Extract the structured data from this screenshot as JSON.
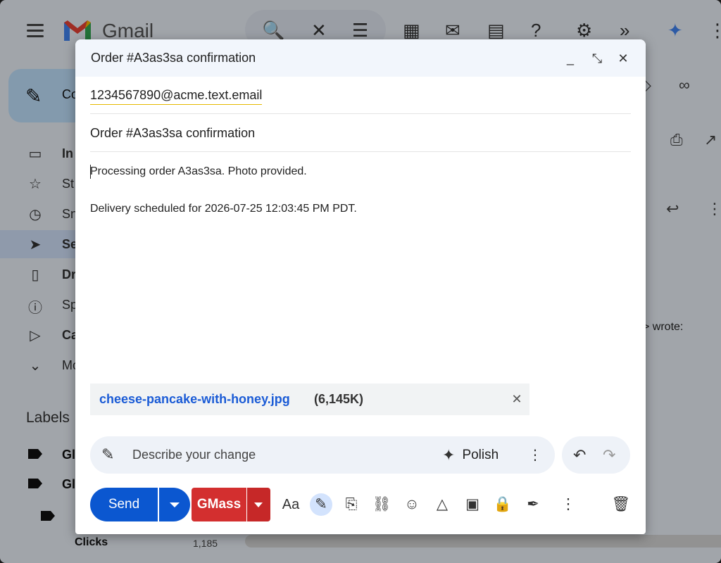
{
  "app": {
    "name": "Gmail"
  },
  "background": {
    "compose_label": "Co",
    "nav": [
      {
        "label": "In",
        "icon": "inbox-icon",
        "bold": true
      },
      {
        "label": "St",
        "icon": "star-icon",
        "bold": false
      },
      {
        "label": "Sn",
        "icon": "clock-icon",
        "bold": false
      },
      {
        "label": "Se",
        "icon": "send-icon",
        "bold": true,
        "active": true
      },
      {
        "label": "Dr",
        "icon": "draft-icon",
        "bold": true
      },
      {
        "label": "Sp",
        "icon": "spam-icon",
        "bold": false
      },
      {
        "label": "Ca",
        "icon": "label-icon",
        "bold": true
      },
      {
        "label": "Mo",
        "icon": "chevron-down-icon",
        "bold": false
      }
    ],
    "labels_title": "Labels",
    "labels": [
      {
        "label": "Gl"
      },
      {
        "label": "Gl"
      }
    ],
    "wrote_prefix": "y",
    "wrote_text": "> wrote:",
    "clicks_label": "Clicks",
    "clicks_count": "1,185"
  },
  "compose": {
    "title": "Order #A3as3sa confirmation",
    "header_buttons": {
      "minimize": "_",
      "exit_fullscreen": "⤡",
      "close": "✕"
    },
    "to": "1234567890@acme.text.email",
    "subject": "Order #A3as3sa confirmation",
    "body_lines": [
      "Processing order A3as3sa. Photo provided.",
      "Delivery scheduled for 2026-07-25 12:03:45 PM PDT."
    ],
    "attachment": {
      "name": "cheese-pancake-with-honey.jpg",
      "size": "(6,145K)"
    },
    "ai": {
      "placeholder": "Describe your change",
      "polish_label": "Polish"
    },
    "send_label": "Send",
    "gmass_label": "GMass",
    "colors": {
      "send": "#0b57d0",
      "gmass": "#d32f2f",
      "attachment_link": "#1a5bd6"
    }
  }
}
